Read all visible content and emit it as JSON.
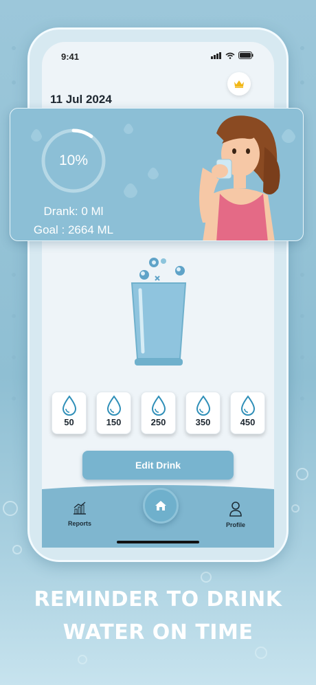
{
  "status_bar": {
    "time": "9:41"
  },
  "header": {
    "date": "11 Jul 2024"
  },
  "progress": {
    "percent_label": "10%",
    "fraction": 0.1,
    "drank": "Drank: 0 Ml",
    "goal": "Goal : 2664 ML"
  },
  "amounts": [
    "50",
    "150",
    "250",
    "350",
    "450"
  ],
  "edit_button": "Edit Drink",
  "nav": {
    "reports": "Reports",
    "profile": "Profile"
  },
  "headline": {
    "line1": "REMINDER TO DRINK",
    "line2": "WATER ON TIME"
  },
  "colors": {
    "accent": "#78b4cf",
    "banner": "#8cbfd6",
    "crown": "#f1b716"
  },
  "icons": [
    "signal-icon",
    "wifi-icon",
    "battery-icon",
    "crown-icon",
    "water-drop-icon",
    "reports-chart-icon",
    "home-icon",
    "profile-icon"
  ]
}
